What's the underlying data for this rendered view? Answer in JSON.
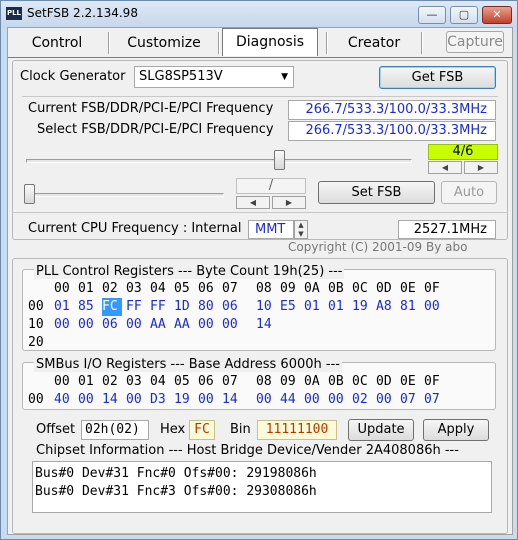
{
  "window": {
    "title": "SetFSB 2.2.134.98",
    "app_icon_text": "PLL",
    "min_glyph": "—",
    "max_glyph": "▢",
    "close_glyph": "✕"
  },
  "tabs": [
    {
      "label": "Control"
    },
    {
      "label": "Customize"
    },
    {
      "label": "Diagnosis",
      "selected": true
    },
    {
      "label": "Creator"
    }
  ],
  "capture_label": "Capture",
  "clock": {
    "label": "Clock Generator",
    "value": "SLG8SP513V",
    "get_fsb": "Get FSB"
  },
  "freq": {
    "current_label": "Current FSB/DDR/PCI-E/PCI Frequency",
    "current_value": "266.7/533.3/100.0/33.3MHz",
    "select_label": "Select FSB/DDR/PCI-E/PCI Frequency",
    "select_value": "266.7/533.3/100.0/33.3MHz",
    "ratio": "4/6",
    "slider_level_pct": 66,
    "slash": "/",
    "set_fsb": "Set FSB",
    "auto": "Auto"
  },
  "cpu": {
    "label": "Current CPU Frequency : Internal",
    "source": "MMT",
    "value": "2527.1MHz",
    "copyright": "Copyright (C) 2001-09 By abo"
  },
  "pll": {
    "header": "PLL Control Registers  --- Byte Count 19h(25) ---",
    "cols_a": [
      "00",
      "01",
      "02",
      "03",
      "04",
      "05",
      "06",
      "07"
    ],
    "cols_b": [
      "08",
      "09",
      "0A",
      "0B",
      "0C",
      "0D",
      "0E",
      "0F"
    ],
    "rows": [
      {
        "addr": "00",
        "a": [
          "01",
          "85",
          "FC",
          "FF",
          "FF",
          "1D",
          "80",
          "06"
        ],
        "b": [
          "10",
          "E5",
          "01",
          "01",
          "19",
          "A8",
          "81",
          "00"
        ]
      },
      {
        "addr": "10",
        "a": [
          "00",
          "00",
          "06",
          "00",
          "AA",
          "AA",
          "00",
          "00"
        ],
        "b": [
          "14",
          "",
          "",
          "",
          "",
          "",
          "",
          ""
        ]
      },
      {
        "addr": "20",
        "a": [
          "",
          "",
          "",
          "",
          "",
          "",
          "",
          ""
        ],
        "b": [
          "",
          "",
          "",
          "",
          "",
          "",
          "",
          ""
        ]
      }
    ],
    "selected_cell": "FC"
  },
  "smbus": {
    "header": "SMBus I/O Registers  --- Base Address 6000h ---",
    "cols_a": [
      "00",
      "01",
      "02",
      "03",
      "04",
      "05",
      "06",
      "07"
    ],
    "cols_b": [
      "08",
      "09",
      "0A",
      "0B",
      "0C",
      "0D",
      "0E",
      "0F"
    ],
    "row": {
      "addr": "00",
      "a": [
        "40",
        "00",
        "14",
        "00",
        "D3",
        "19",
        "00",
        "14"
      ],
      "b": [
        "00",
        "44",
        "00",
        "00",
        "02",
        "00",
        "07",
        "07"
      ]
    }
  },
  "offset": {
    "offset_label": "Offset",
    "offset_value": "02h(02)",
    "hex_label": "Hex",
    "hex_value": "FC",
    "bin_label": "Bin",
    "bin_value": "11111100",
    "update": "Update",
    "apply": "Apply"
  },
  "chipset": {
    "header": "Chipset Information  --- Host Bridge Device/Vender 2A408086h ---",
    "lines": [
      "Bus#0 Dev#31 Fnc#0 Ofs#00: 29198086h",
      "Bus#0 Dev#31 Fnc#3 Ofs#00: 29308086h"
    ]
  },
  "colors": {
    "value_blue": "#1b2ccf",
    "ratio_green": "#c8ff00",
    "hex_yellow": "#fffbd8",
    "selection": "#3399ff"
  }
}
